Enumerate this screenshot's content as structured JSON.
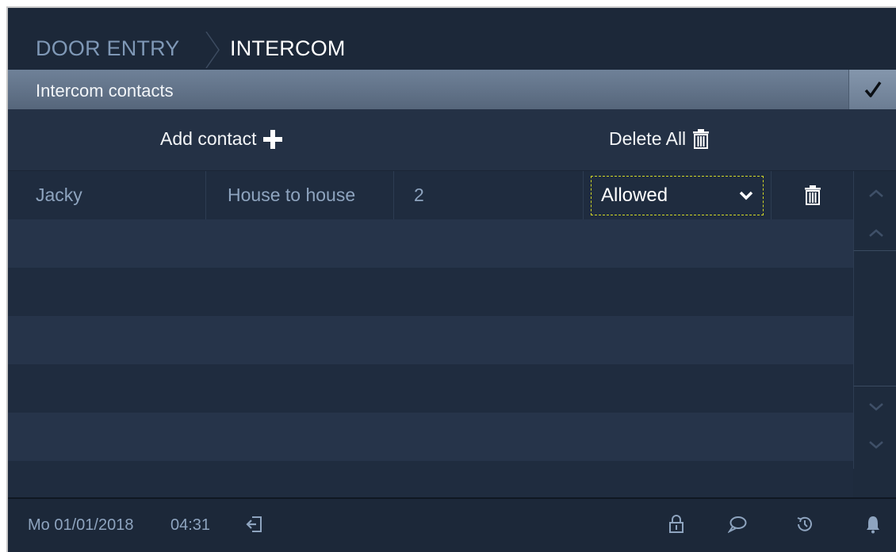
{
  "header": {
    "crumbs": [
      "DOOR ENTRY",
      "INTERCOM"
    ]
  },
  "section": {
    "title": "Intercom contacts"
  },
  "actions": {
    "add_label": "Add contact",
    "delete_all_label": "Delete All"
  },
  "contacts": [
    {
      "name": "Jacky",
      "type": "House to house",
      "number": "2",
      "permission": "Allowed"
    }
  ],
  "footer": {
    "date": "Mo 01/01/2018",
    "time": "04:31"
  },
  "colors": {
    "accent_dashed": "#d2d826",
    "text_muted": "#8ea4bf"
  },
  "icons": [
    "check-icon",
    "plus-icon",
    "trash-icon",
    "chevron-down-icon",
    "chevron-up-icon",
    "exit-icon",
    "lock-icon",
    "message-icon",
    "history-icon",
    "bell-icon"
  ]
}
